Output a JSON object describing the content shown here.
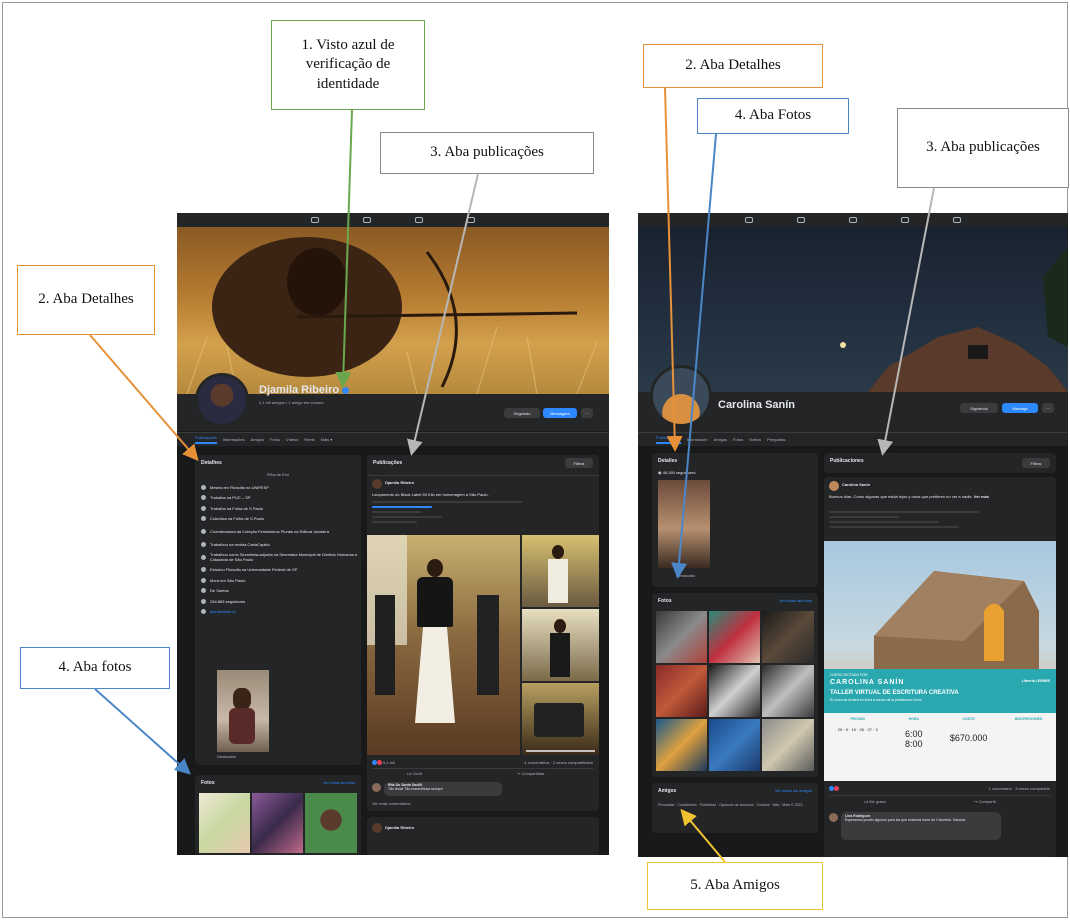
{
  "annotations": {
    "verified_badge": "1. Visto azul de verificação de identidade",
    "left_details_tab": "2. Aba Detalhes",
    "left_posts_tab": "3. Aba publicações",
    "left_photos_tab": "4. Aba fotos",
    "right_details_tab": "2. Aba Detalhes",
    "right_photos_tab": "4. Aba Fotos",
    "right_posts_tab": "3. Aba publicações",
    "right_friends_tab": "5. Aba Amigos"
  },
  "colors": {
    "verified": "#6aa84f",
    "details": "#e69138",
    "posts": "#b7b7b7",
    "photos": "#4a86c8",
    "friends": "#f1c232",
    "facebook_blue": "#2d88ff"
  },
  "left_profile": {
    "name": "Djamila Ribeiro",
    "subline": "2,1 mil amigos • 1 amigo em comum",
    "follow_button": "Seguindo",
    "message_button": "Mensagem",
    "tabs": [
      "Publicações",
      "Informações",
      "Amigos",
      "Fotos",
      "Vídeos",
      "Reels",
      "Mais ▾"
    ],
    "details_title": "Detalhes",
    "details_subtitle": "Filha de Exú",
    "details_items": [
      "Mestra em Filosofia na UNIFESP",
      "Trabalha na PUC – SP",
      "Trabalha na Folha de S.Paulo",
      "Colunista na Folha de S.Paulo",
      "Coordenadora da Coleção Feminismos Plurais na Editora Jandaíra",
      "Trabalhou na revista CartaCapital",
      "Trabalhou como Secretária-adjunta na Secretaria Municipal de Direitos Humanos e Cidadania de São Paulo",
      "Estudou Filosofia na Universidade Federal de SP",
      "Mora em São Paulo",
      "De Santos",
      "254.865 seguidores",
      "djamilaribeiro1"
    ],
    "details_photo_caption": "Destacado",
    "posts_title": "Publicações",
    "posts_filter": "Filtros",
    "post_author": "Djamila Ribeiro",
    "post_text": "Lançamento do Black Label 50 Kilo em homenagem a São Paulo.",
    "post_like": "Curtir",
    "post_share": "Compartilhar",
    "post_reaction_count": "5,1 mil",
    "post_stats": "4 comentários · 2 vezes compartilhado",
    "comment_author": "Rita Do Santo Sacilli",
    "comment_text": "Tão linda! Tão maravilhosa sempre",
    "more_comments": "Ver mais comentários",
    "second_post_author": "Djamila Ribeiro",
    "photos_title": "Fotos",
    "photos_link": "Ver todas as fotos"
  },
  "right_profile": {
    "name": "Carolina Sanín",
    "follow_button": "Siguiendo",
    "message_button": "Mensaje",
    "tabs": [
      "Publicaciones",
      "Información",
      "Amigos",
      "Fotos",
      "Videos",
      "Preguntas"
    ],
    "details_title": "Detalles",
    "details_followers": "46.280 seguidores",
    "details_photo_caption": "Destacado",
    "photos_title": "Fotos",
    "photos_link": "Ver todas las fotos",
    "friends_title": "Amigos",
    "friends_link": "Ver todos los amigos",
    "friends_footer": "Privacidad · Condiciones · Publicidad · Opciones de anuncios · Cookies · Más · Meta © 2023",
    "posts_title": "Publicaciones",
    "posts_filter": "Filtros",
    "post_author": "Carolina Sanín",
    "post_text": "Buenos días. Como algunas que están lejos y otros que prefieren no ver a nadie.",
    "post_see_more": "Ver más",
    "banner_tag": "CURSO DICTADO POR",
    "banner_name": "CAROLINA SANÍN",
    "banner_title": "TALLER VIRTUAL DE ESCRITURA CREATIVA",
    "banner_subtitle": "El curso se dictará en línea a través de la plataforma Zoom",
    "banner_brand": "Librería LERNER",
    "banner_cols": [
      "FECHAS",
      "HORA",
      "COSTO",
      "INSCRIPCIONES"
    ],
    "banner_date": "29 · 5 · 19 · 26 · 27 · 3",
    "banner_time_a": "6:00",
    "banner_time_b": "8:00",
    "banner_price": "$670.000",
    "post_stats": "1 comentario · 3 veces compartido",
    "post_like": "Me gusta",
    "post_share": "Compartir",
    "comment_author": "Lina Rodríguez",
    "comment_text": "Esperamos pronto algunos para las que estamos fuera de Colombia. Saludos"
  }
}
